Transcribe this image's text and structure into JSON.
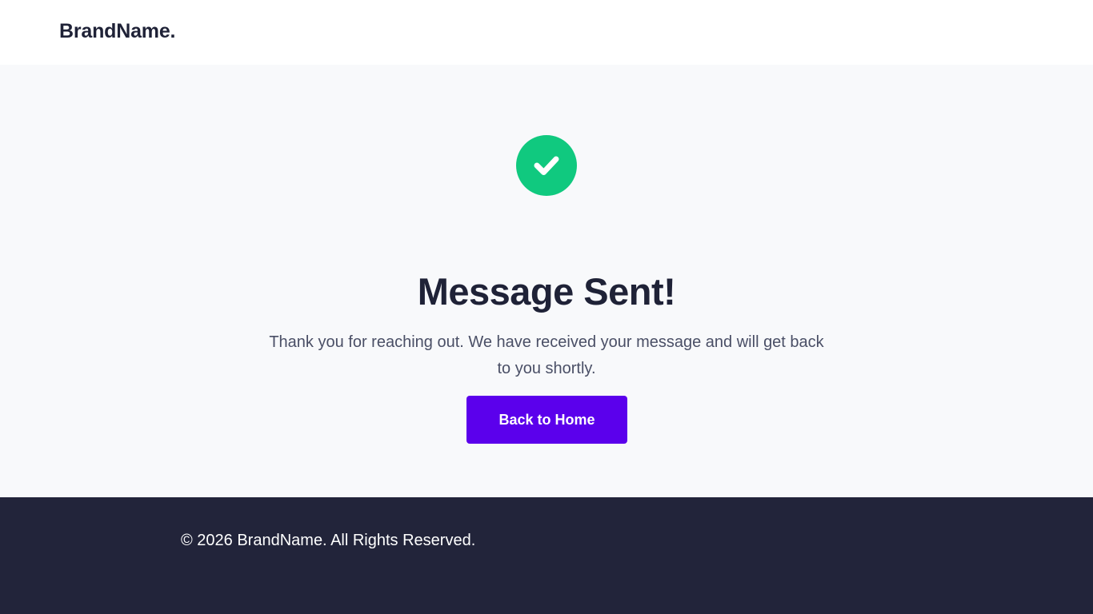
{
  "header": {
    "brand": "BrandName."
  },
  "main": {
    "icon": "check-circle-icon",
    "icon_color": "#10c97f",
    "title": "Message Sent!",
    "message": "Thank you for reaching out. We have received your message and will get back to you shortly.",
    "button_label": "Back to Home",
    "button_color": "#5b00ec"
  },
  "footer": {
    "copyright": "© 2026 BrandName. All Rights Reserved."
  }
}
